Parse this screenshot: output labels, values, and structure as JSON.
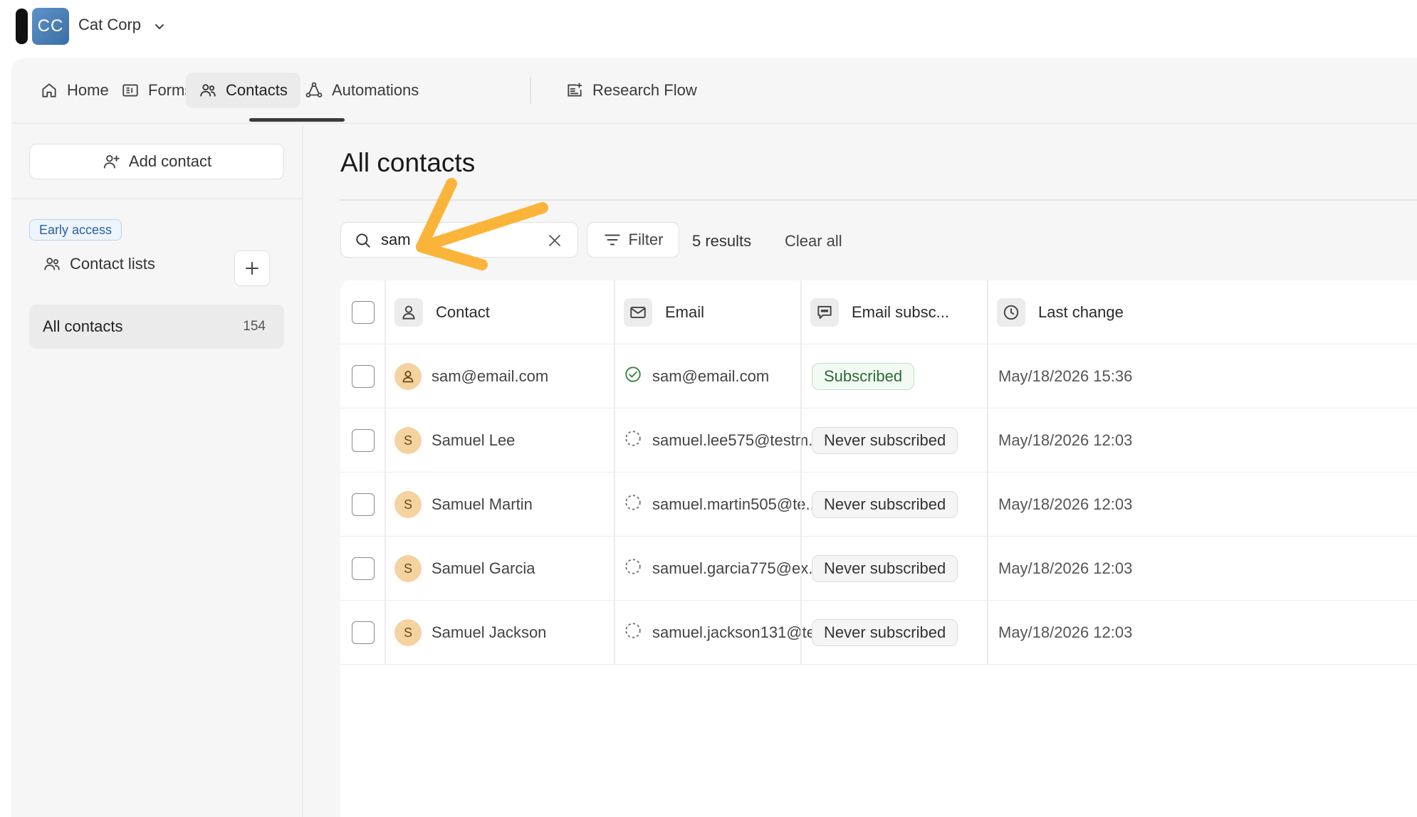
{
  "org": {
    "initials": "CC",
    "name": "Cat Corp"
  },
  "nav": [
    {
      "label": "Home",
      "icon": "home-icon"
    },
    {
      "label": "Forms",
      "icon": "forms-icon"
    },
    {
      "label": "Contacts",
      "icon": "contacts-icon",
      "active": true
    },
    {
      "label": "Automations",
      "icon": "automations-icon"
    },
    {
      "label": "Research Flow",
      "icon": "research-flow-icon"
    }
  ],
  "sidebar": {
    "add_contact_label": "Add contact",
    "early_access_label": "Early access",
    "contact_lists_label": "Contact lists",
    "all_contacts": {
      "label": "All contacts",
      "count": "154"
    }
  },
  "main": {
    "title": "All contacts",
    "search": {
      "value": "sam",
      "placeholder": ""
    },
    "filter_label": "Filter",
    "results_label": "5 results",
    "clear_all_label": "Clear all"
  },
  "table": {
    "columns": [
      {
        "label": "Contact",
        "icon": "person-icon"
      },
      {
        "label": "Email",
        "icon": "mail-icon"
      },
      {
        "label": "Email subsc...",
        "icon": "chat-icon"
      },
      {
        "label": "Last change",
        "icon": "clock-icon"
      }
    ],
    "rows": [
      {
        "contact": "sam@email.com",
        "avatar": "",
        "email": "sam@email.com",
        "email_verified": true,
        "subscription": "Subscribed",
        "last_change": "May/18/2026 15:36"
      },
      {
        "contact": "Samuel Lee",
        "avatar": "S",
        "email": "samuel.lee575@testm...",
        "email_verified": false,
        "subscription": "Never subscribed",
        "last_change": "May/18/2026 12:03"
      },
      {
        "contact": "Samuel Martin",
        "avatar": "S",
        "email": "samuel.martin505@te...",
        "email_verified": false,
        "subscription": "Never subscribed",
        "last_change": "May/18/2026 12:03"
      },
      {
        "contact": "Samuel Garcia",
        "avatar": "S",
        "email": "samuel.garcia775@ex...",
        "email_verified": false,
        "subscription": "Never subscribed",
        "last_change": "May/18/2026 12:03"
      },
      {
        "contact": "Samuel Jackson",
        "avatar": "S",
        "email": "samuel.jackson131@te...",
        "email_verified": false,
        "subscription": "Never subscribed",
        "last_change": "May/18/2026 12:03"
      }
    ]
  },
  "colors": {
    "accent": "#3b3b3b",
    "subscribed": "#2a6a33",
    "annotation_arrow": "#fbb43a",
    "avatar_bg": "#f5d3a1"
  }
}
